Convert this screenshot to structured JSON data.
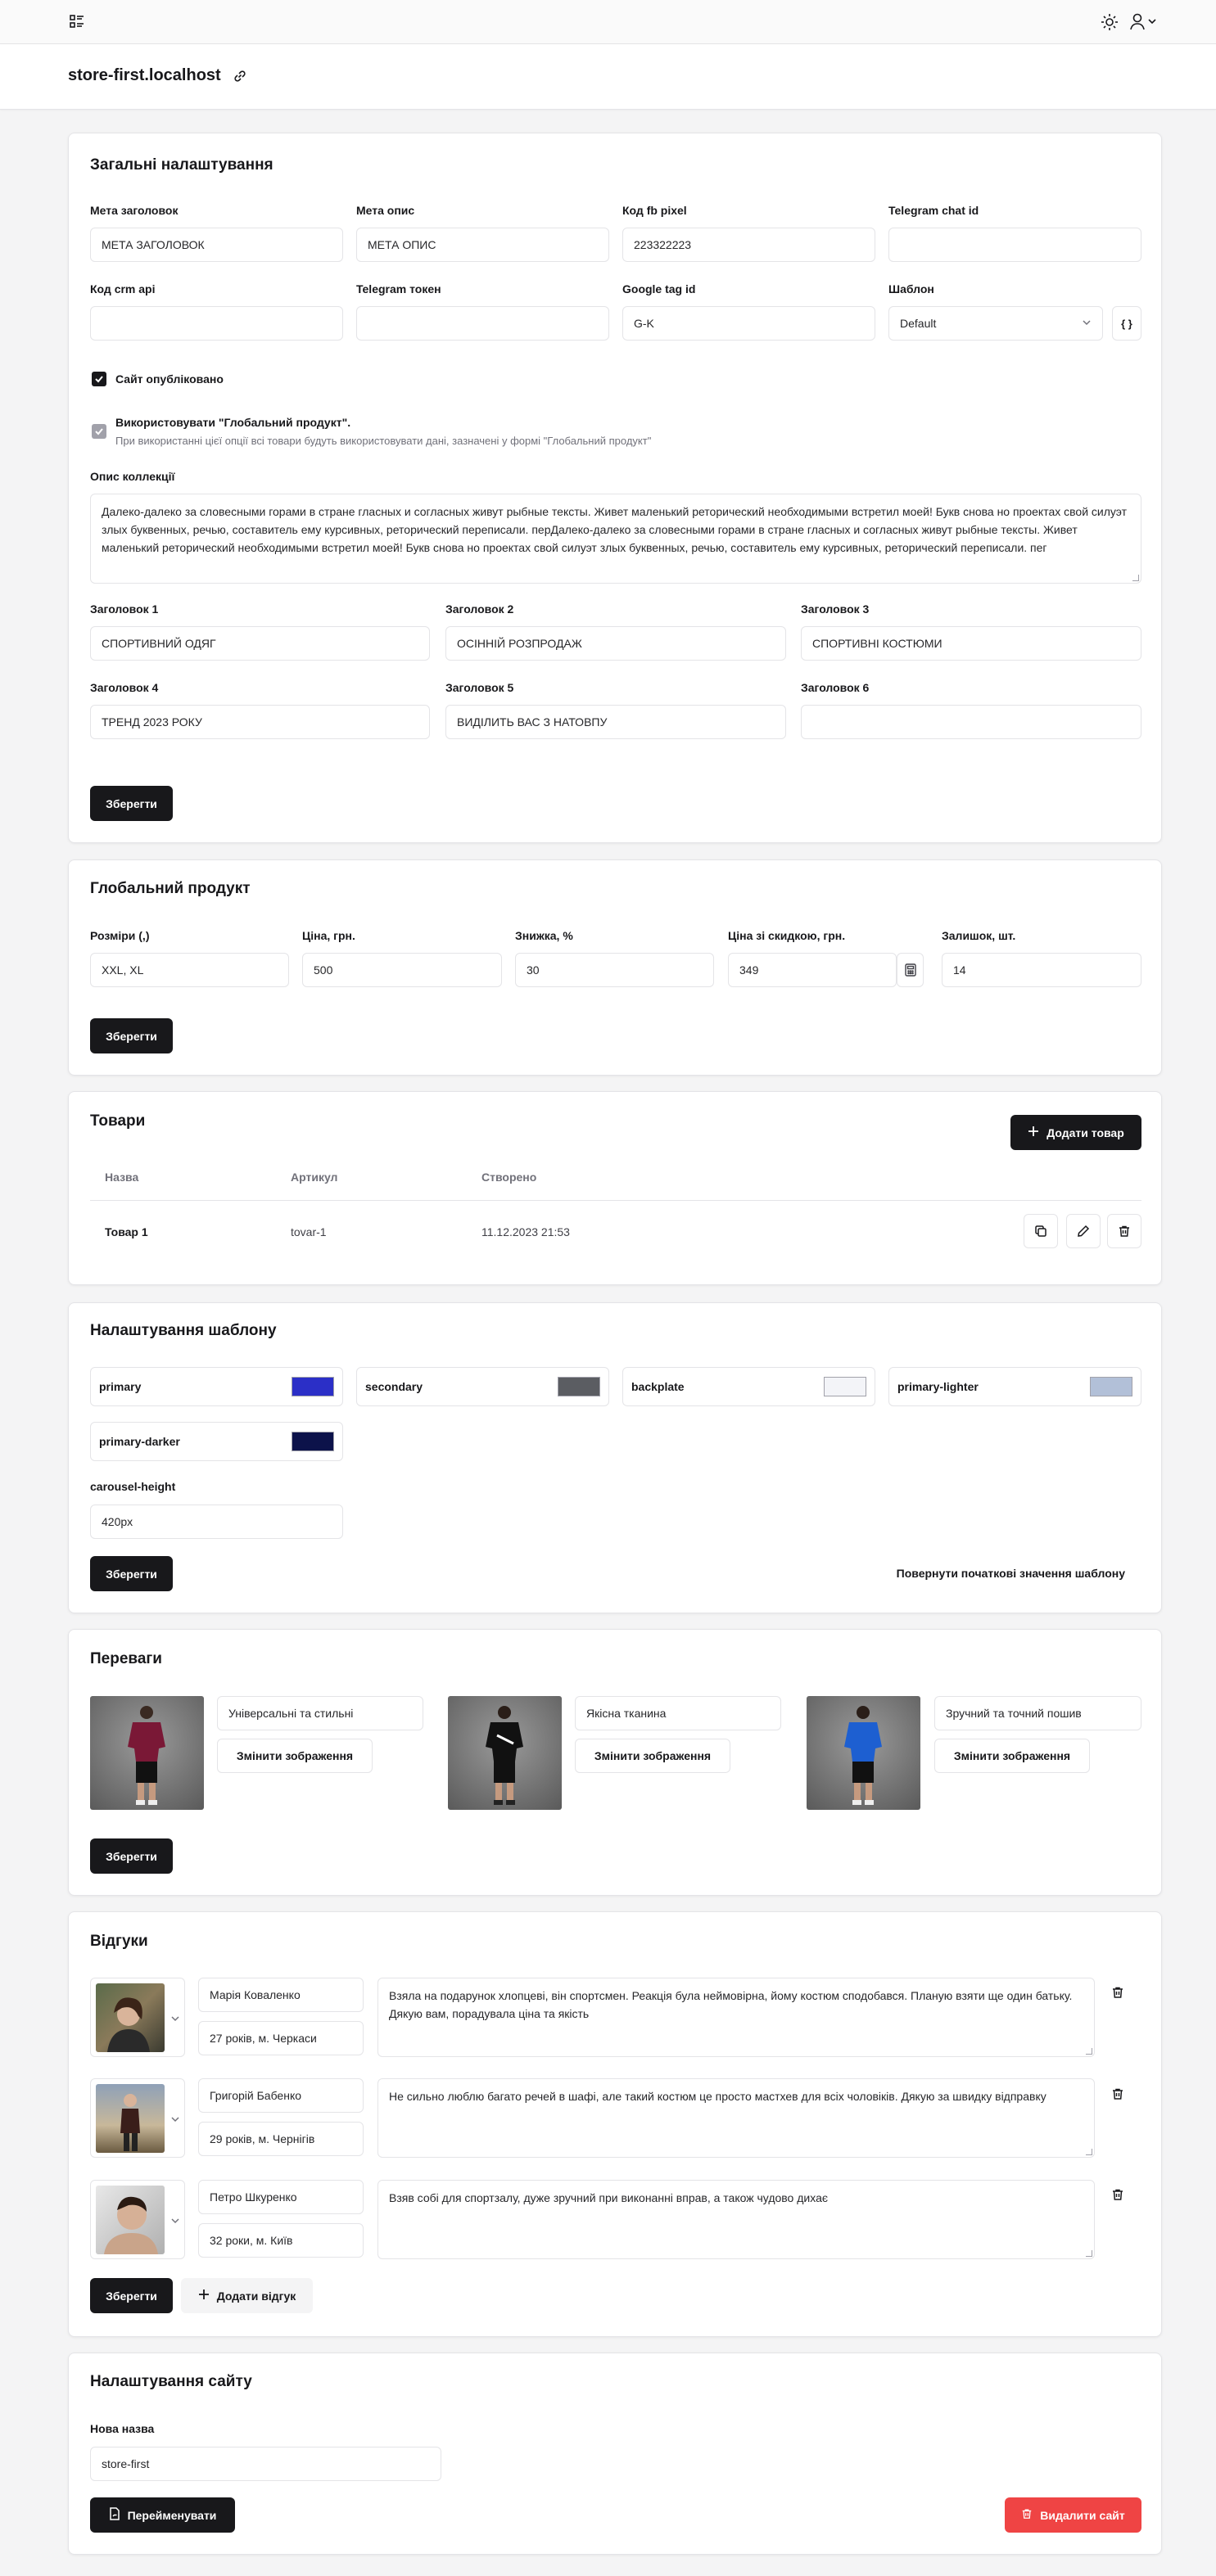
{
  "header": {
    "store_title": "store-first.localhost"
  },
  "general": {
    "title": "Загальні налаштування",
    "fields": [
      {
        "label": "Мета заголовок",
        "value": "МЕТА ЗАГОЛОВОК"
      },
      {
        "label": "Мета опис",
        "value": "МЕТА ОПИС"
      },
      {
        "label": "Код fb pixel",
        "value": "223322223"
      },
      {
        "label": "Telegram chat id",
        "value": ""
      },
      {
        "label": "Код crm api",
        "value": ""
      },
      {
        "label": "Telegram токен",
        "value": ""
      },
      {
        "label": "Google tag id",
        "value": "G-K"
      },
      {
        "label": "Шаблон",
        "value": "Default"
      }
    ],
    "template_json_button": "{ }",
    "published_label": "Сайт опубліковано",
    "published_checked": true,
    "global_product_label": "Використовувати \"Глобальний продукт\".",
    "global_product_hint": "При використанні цієї опції всі товари будуть використовувати дані, зазначені у формі \"Глобальний продукт\"",
    "global_product_checked": true,
    "collection_label": "Опис коллекції",
    "collection_text": "Далеко-далеко за словесными горами в стране гласных и согласных живут рыбные тексты. Живет маленький реторический необходимыми встретил моей! Букв снова но проектах свой силуэт злых буквенных, речью, составитель ему курсивных, реторический переписали. перДалеко-далеко за словесными горами в стране гласных и согласных живут рыбные тексты. Живет маленький реторический необходимыми встретил моей! Букв снова но проектах свой силуэт злых буквенных, речью, составитель ему курсивных, реторический переписали. пег",
    "headings": [
      {
        "label": "Заголовок 1",
        "value": "СПОРТИВНИЙ ОДЯГ"
      },
      {
        "label": "Заголовок 2",
        "value": "ОСІННІЙ РОЗПРОДАЖ"
      },
      {
        "label": "Заголовок 3",
        "value": "СПОРТИВНІ КОСТЮМИ"
      },
      {
        "label": "Заголовок 4",
        "value": "ТРЕНД 2023 РОКУ"
      },
      {
        "label": "Заголовок 5",
        "value": "ВИДІЛИТЬ ВАС З НАТОВПУ"
      },
      {
        "label": "Заголовок 6",
        "value": ""
      }
    ],
    "save_label": "Зберегти"
  },
  "global_product": {
    "title": "Глобальний продукт",
    "fields": [
      {
        "label": "Розміри (,)",
        "value": "XXL, XL"
      },
      {
        "label": "Ціна, грн.",
        "value": "500"
      },
      {
        "label": "Знижка, %",
        "value": "30"
      },
      {
        "label": "Ціна зі скидкою, грн.",
        "value": "349"
      },
      {
        "label": "Залишок, шт.",
        "value": "14"
      }
    ],
    "save_label": "Зберегти"
  },
  "products": {
    "title": "Товари",
    "add_label": "Додати товар",
    "columns": [
      "Назва",
      "Артикул",
      "Створено"
    ],
    "rows": [
      {
        "name": "Товар 1",
        "sku": "tovar-1",
        "created": "11.12.2023 21:53"
      }
    ]
  },
  "template_settings": {
    "title": "Налаштування шаблону",
    "colors": [
      {
        "name": "primary",
        "hex": "#2b2fc7"
      },
      {
        "name": "secondary",
        "hex": "#5b5d62"
      },
      {
        "name": "backplate",
        "hex": "#f3f4f8"
      },
      {
        "name": "primary-lighter",
        "hex": "#b2c0d8"
      },
      {
        "name": "primary-darker",
        "hex": "#0c124a"
      }
    ],
    "carousel_label": "carousel-height",
    "carousel_value": "420px",
    "save_label": "Зберегти",
    "reset_label": "Повернути початкові значення шаблону"
  },
  "advantages": {
    "title": "Переваги",
    "items": [
      {
        "text": "Універсальні та стильні",
        "shirt": "#7a1836",
        "change_label": "Змінити зображення"
      },
      {
        "text": "Якісна тканина",
        "shirt": "#111111",
        "change_label": "Змінити зображення"
      },
      {
        "text": "Зручний та точний пошив",
        "shirt": "#1d5fd1",
        "change_label": "Змінити зображення"
      }
    ],
    "save_label": "Зберегти"
  },
  "reviews": {
    "title": "Відгуки",
    "items": [
      {
        "name": "Марія Коваленко",
        "meta": "27 років, м. Черкаси",
        "text": "Взяла на подарунок хлопцеві, він спортсмен. Реакція була неймовірна, йому костюм сподобався. Планую взяти ще один батьку. Дякую вам, порадувала ціна та якість"
      },
      {
        "name": "Григорій Бабенко",
        "meta": "29 років, м. Чернігів",
        "text": "Не сильно люблю багато речей в шафі, але такий костюм це просто мастхев для всіх чоловіків. Дякую за швидку відправку"
      },
      {
        "name": "Петро Шкуренко",
        "meta": "32 роки, м. Київ",
        "text": "Взяв собі для спортзалу, дуже зручний при виконанні вправ, а також чудово дихає"
      }
    ],
    "save_label": "Зберегти",
    "add_label": "Додати відгук"
  },
  "site_settings": {
    "title": "Налаштування сайту",
    "name_label": "Нова назва",
    "name_value": "store-first",
    "rename_label": "Перейменувати",
    "delete_label": "Видалити сайт"
  },
  "colors": {
    "accent_dark": "#18181b",
    "danger": "#ef4444"
  }
}
